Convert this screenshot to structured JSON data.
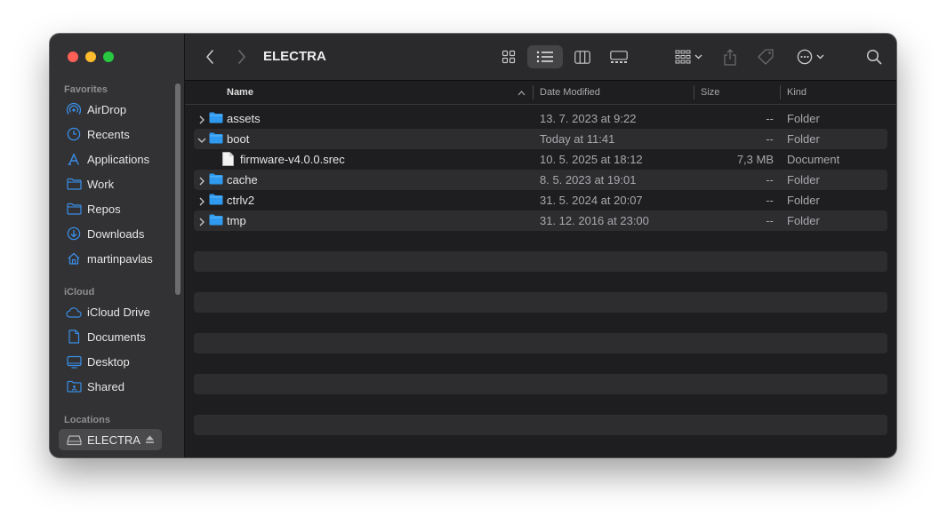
{
  "window": {
    "title": "ELECTRA"
  },
  "sidebar": {
    "favorites_label": "Favorites",
    "icloud_label": "iCloud",
    "locations_label": "Locations",
    "favorites": [
      {
        "label": "AirDrop",
        "icon": "airdrop-icon"
      },
      {
        "label": "Recents",
        "icon": "clock-icon"
      },
      {
        "label": "Applications",
        "icon": "applications-icon"
      },
      {
        "label": "Work",
        "icon": "folder-icon"
      },
      {
        "label": "Repos",
        "icon": "folder-icon"
      },
      {
        "label": "Downloads",
        "icon": "download-icon"
      },
      {
        "label": "martinpavlas",
        "icon": "home-icon"
      }
    ],
    "icloud": [
      {
        "label": "iCloud Drive",
        "icon": "cloud-icon"
      },
      {
        "label": "Documents",
        "icon": "document-icon"
      },
      {
        "label": "Desktop",
        "icon": "desktop-icon"
      },
      {
        "label": "Shared",
        "icon": "shared-folder-icon"
      }
    ],
    "locations": [
      {
        "label": "ELECTRA",
        "icon": "drive-icon",
        "selected": true
      }
    ]
  },
  "columns": {
    "name": "Name",
    "date": "Date Modified",
    "size": "Size",
    "kind": "Kind"
  },
  "files": [
    {
      "name": "assets",
      "date": "13. 7. 2023 at 9:22",
      "size": "--",
      "kind": "Folder",
      "type": "folder",
      "expanded": false,
      "depth": 0
    },
    {
      "name": "boot",
      "date": "Today at 11:41",
      "size": "--",
      "kind": "Folder",
      "type": "folder",
      "expanded": true,
      "depth": 0
    },
    {
      "name": "firmware-v4.0.0.srec",
      "date": "10. 5. 2025 at 18:12",
      "size": "7,3 MB",
      "kind": "Document",
      "type": "file",
      "expanded": false,
      "depth": 1
    },
    {
      "name": "cache",
      "date": "8. 5. 2023 at 19:01",
      "size": "--",
      "kind": "Folder",
      "type": "folder",
      "expanded": false,
      "depth": 0
    },
    {
      "name": "ctrlv2",
      "date": "31. 5. 2024 at 20:07",
      "size": "--",
      "kind": "Folder",
      "type": "folder",
      "expanded": false,
      "depth": 0
    },
    {
      "name": "tmp",
      "date": "31. 12. 2016 at 23:00",
      "size": "--",
      "kind": "Folder",
      "type": "folder",
      "expanded": false,
      "depth": 0
    }
  ],
  "colors": {
    "accent": "#0a84ff",
    "folder": "#2e9bf0",
    "window_bg": "#1e1e20",
    "sidebar_bg": "#323234"
  }
}
